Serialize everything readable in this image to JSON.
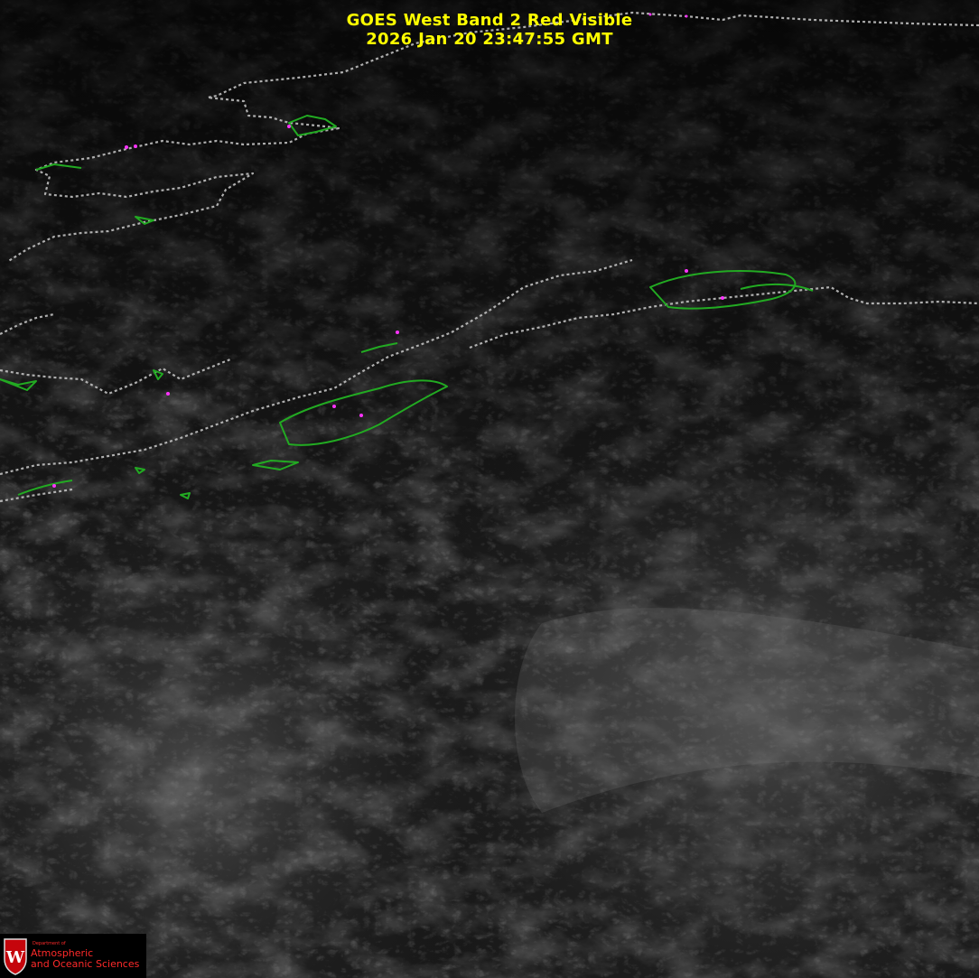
{
  "title": {
    "line1": "GOES West Band 2 Red Visible",
    "line2": "2026 Jan 20  23:47:55 GMT"
  },
  "colors": {
    "title": "#ffff00",
    "coastline": "#22aa22",
    "border": "#c0c0c0",
    "markers": "#ff33ff",
    "logo_text": "#ff2a2a",
    "background": "#0b0b0b"
  },
  "logo": {
    "dept_label": "Department of",
    "line1": "Atmospheric",
    "line2": "and Oceanic Sciences",
    "icon": "uw-crest-icon"
  }
}
